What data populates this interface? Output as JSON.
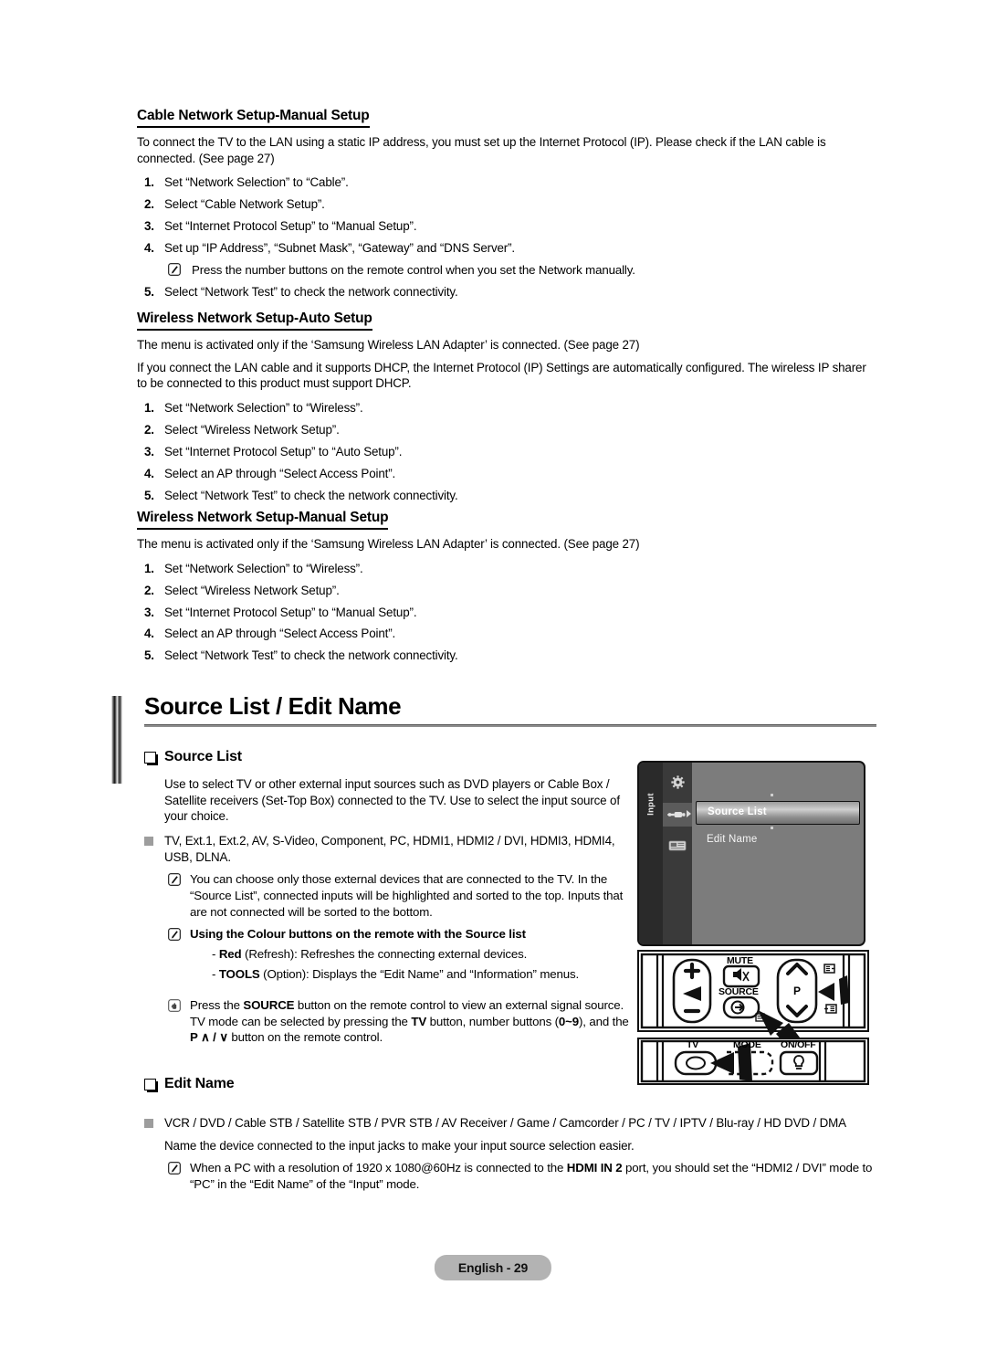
{
  "sections": {
    "cable_manual": {
      "heading": "Cable Network Setup-Manual Setup",
      "intro": "To connect the TV to the LAN using a static IP address, you must set up the Internet Protocol (IP). Please check if the LAN cable is connected. (See page 27)",
      "steps": [
        "Set “Network Selection” to “Cable”.",
        "Select “Cable Network Setup”.",
        "Set “Internet Protocol Setup” to “Manual Setup”.",
        "Set up “IP Address”, “Subnet Mask”, “Gateway” and “DNS Server”.",
        "Select “Network Test” to check the network connectivity."
      ],
      "note_after_step4": "Press the number buttons on the remote control when you set the Network manually."
    },
    "wireless_auto": {
      "heading": "Wireless Network Setup-Auto Setup",
      "intro1": "The menu is activated only if the ‘Samsung Wireless LAN Adapter’ is connected. (See page 27)",
      "intro2": "If you connect the LAN cable and it supports DHCP, the Internet Protocol (IP) Settings are automatically configured. The wireless IP sharer to be connected to this product must support DHCP.",
      "steps": [
        "Set “Network Selection” to “Wireless”.",
        "Select “Wireless Network Setup”.",
        "Set “Internet Protocol Setup” to “Auto Setup”.",
        "Select an AP through “Select Access Point”.",
        "Select “Network Test” to check the network connectivity."
      ]
    },
    "wireless_manual": {
      "heading": "Wireless Network Setup-Manual Setup",
      "intro": "The menu is activated only if the ‘Samsung Wireless LAN Adapter’ is connected. (See page 27)",
      "steps": [
        "Set “Network Selection” to “Wireless”.",
        "Select “Wireless Network Setup”.",
        "Set “Internet Protocol Setup” to “Manual Setup”.",
        "Select an AP through “Select Access Point”.",
        "Select “Network Test” to check the network connectivity."
      ]
    }
  },
  "main": {
    "title": "Source List / Edit Name",
    "source_list": {
      "heading": "Source List",
      "para": "Use to select TV or other external input sources such as DVD players or Cable Box / Satellite receivers (Set-Top Box) connected to the TV. Use to select the input source of your choice.",
      "inputs": "TV, Ext.1, Ext.2, AV, S-Video, Component, PC, HDMI1, HDMI2 / DVI, HDMI3, HDMI4, USB, DLNA.",
      "note1": "You can choose only those external devices that are connected to the TV. In the “Source List”, connected inputs will be highlighted and sorted to the top. Inputs that are not connected will be sorted to the bottom.",
      "note2_title": "Using the Colour buttons on the remote with the Source list",
      "note2_red_key": "Red",
      "note2_red_text": " (Refresh): Refreshes the connecting external devices.",
      "note2_tools_key": "TOOLS",
      "note2_tools_text": " (Option): Displays the “Edit Name” and “Information” menus.",
      "press_note_a": "Press the ",
      "press_note_source": "SOURCE",
      "press_note_b": " button on the remote control to view an external signal source. TV mode can be selected by pressing the ",
      "press_note_tv": "TV",
      "press_note_c": " button, number buttons (",
      "press_note_range": "0~9",
      "press_note_d": "), and the ",
      "press_note_p": "P",
      "press_note_e": " button on the remote control."
    },
    "edit_name": {
      "heading": "Edit Name",
      "devices": "VCR / DVD / Cable STB / Satellite STB / PVR STB / AV Receiver / Game / Camcorder / PC / TV / IPTV / Blu-ray / HD DVD / DMA",
      "para": "Name the device connected to the input jacks to make your input source selection easier.",
      "note_a": "When a PC with a resolution of 1920 x 1080@60Hz is connected to the ",
      "note_hdmi": "HDMI IN 2",
      "note_b": " port, you should set the “HDMI2 / DVI” mode to “PC” in the “Edit Name” of the “Input” mode."
    }
  },
  "osd": {
    "rail_label": "Input",
    "items": [
      {
        "label": "Source List",
        "selected": true
      },
      {
        "label": "Edit Name",
        "selected": false
      }
    ],
    "icons": [
      "gear-icon",
      "plug-icon",
      "card-icon"
    ]
  },
  "remote": {
    "mute_label": "MUTE",
    "source_label": "SOURCE",
    "p_label": "P",
    "plus_label": "+",
    "minus_label": "−",
    "tv_label": "TV",
    "mode_label": "MODE",
    "onoff_label": "ON/OFF"
  },
  "footer": {
    "page_label": "English - 29"
  },
  "colors": {
    "bullet_gray": "#9d9d9d",
    "rule_gray": "#8d8d8d",
    "footer_bg": "#b3b3b3",
    "osd_bg": "#7c7c7c",
    "osd_rail": "#2a2a2a"
  }
}
